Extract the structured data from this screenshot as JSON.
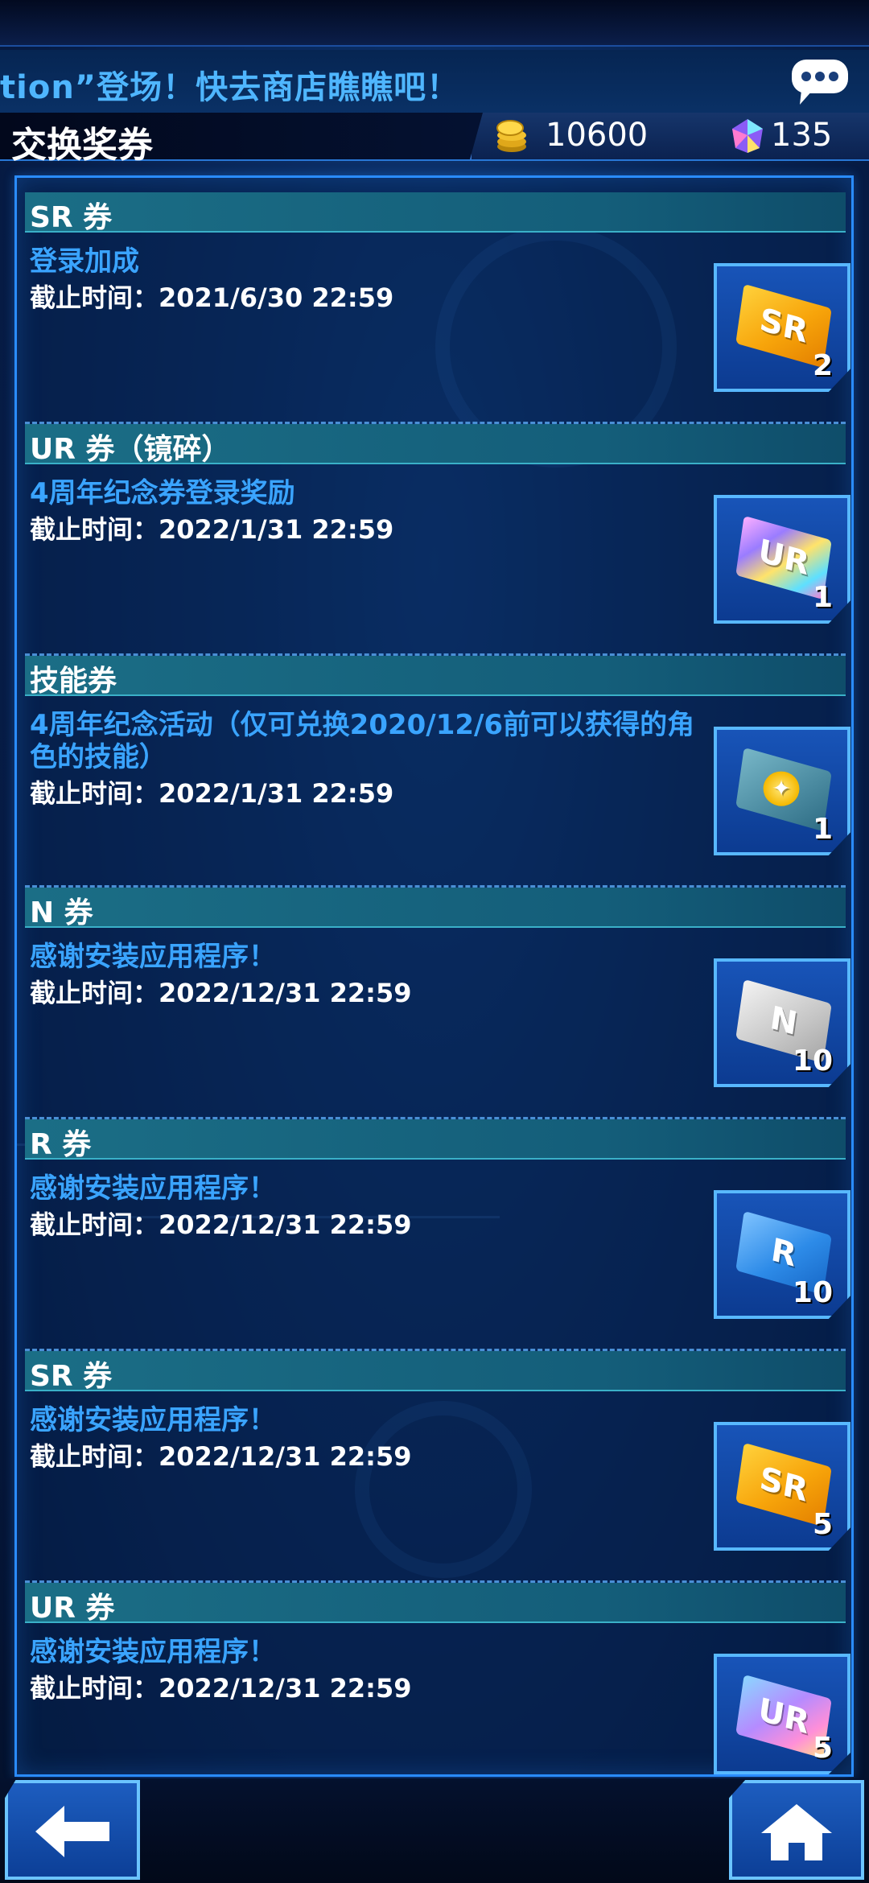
{
  "ticker": {
    "text": "tion”登场！快去商店瞧瞧吧！"
  },
  "header": {
    "title": "交换奖券"
  },
  "currency": {
    "coins": "10600",
    "gems": "135"
  },
  "tickets": [
    {
      "title": "SR 券",
      "source": "登录加成",
      "deadline": "截止时间：2021/6/30 22:59",
      "badge": "SR",
      "count": "2",
      "icon": "sr-ticket-icon"
    },
    {
      "title": "UR 券（镜碎）",
      "source": "4周年纪念券登录奖励",
      "deadline": "截止时间：2022/1/31 22:59",
      "badge": "UR",
      "count": "1",
      "icon": "ur-shatter-ticket-icon"
    },
    {
      "title": "技能券",
      "source": "4周年纪念活动（仅可兑换2020/12/6前可以获得的角色的技能）",
      "deadline": "截止时间：2022/1/31 22:59",
      "badge": "",
      "count": "1",
      "icon": "skill-ticket-icon"
    },
    {
      "title": "N 券",
      "source": "感谢安装应用程序！",
      "deadline": "截止时间：2022/12/31 22:59",
      "badge": "N",
      "count": "10",
      "icon": "n-ticket-icon"
    },
    {
      "title": "R 券",
      "source": "感谢安装应用程序！",
      "deadline": "截止时间：2022/12/31 22:59",
      "badge": "R",
      "count": "10",
      "icon": "r-ticket-icon"
    },
    {
      "title": "SR 券",
      "source": "感谢安装应用程序！",
      "deadline": "截止时间：2022/12/31 22:59",
      "badge": "SR",
      "count": "5",
      "icon": "sr-ticket-icon"
    },
    {
      "title": "UR 券",
      "source": "感谢安装应用程序！",
      "deadline": "截止时间：2022/12/31 22:59",
      "badge": "UR",
      "count": "5",
      "icon": "ur-ticket-icon"
    }
  ],
  "nav": {
    "back_icon": "back-arrow-icon",
    "home_icon": "home-icon"
  }
}
